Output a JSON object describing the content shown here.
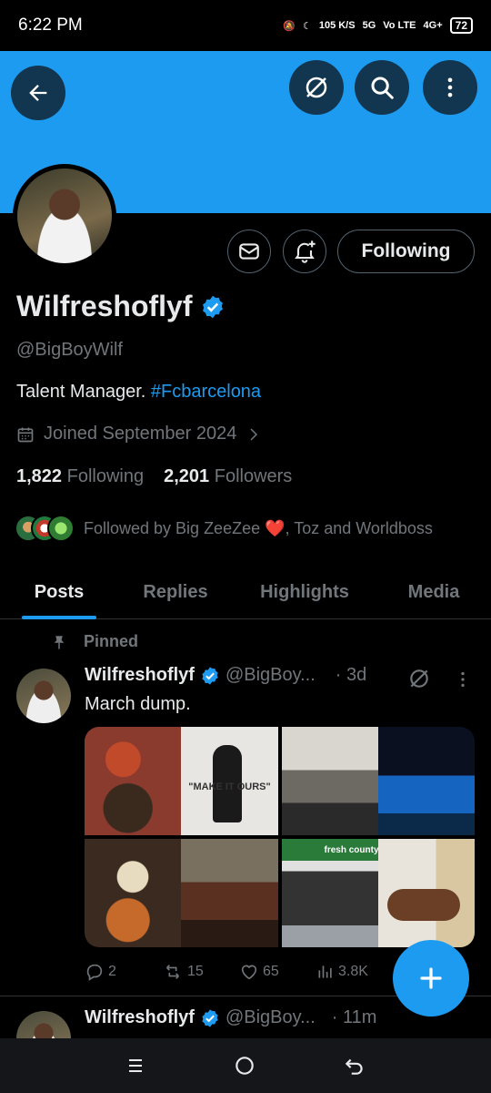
{
  "status_bar": {
    "time": "6:22 PM",
    "net_speed": "105 K/S",
    "net_1": "5G",
    "net_2": "Vo LTE",
    "net_3": "4G+",
    "battery": "72"
  },
  "header": {
    "back_icon": "arrow-left-icon",
    "grok_icon": "grok-icon",
    "search_icon": "search-icon",
    "more_icon": "more-vertical-icon",
    "banner_color": "#1d9bf0"
  },
  "profile": {
    "display_name": "Wilfreshoflyf",
    "handle": "@BigBoyWilf",
    "bio_text": "Talent Manager. ",
    "bio_tag": "#Fcbarcelona",
    "joined": "Joined September 2024",
    "following_count": "1,822",
    "following_label": "Following",
    "followers_count": "2,201",
    "followers_label": "Followers",
    "followed_by": "Followed by Big ZeeZee ❤️, Toz and Worldboss",
    "follow_button": "Following"
  },
  "tabs": [
    {
      "label": "Posts",
      "active": true
    },
    {
      "label": "Replies",
      "active": false
    },
    {
      "label": "Highlights",
      "active": false
    },
    {
      "label": "Media",
      "active": false
    }
  ],
  "pinned_post": {
    "pinned_label": "Pinned",
    "name": "Wilfreshoflyf",
    "handle": "@BigBoy...",
    "time": "· 3d",
    "text": "March dump.",
    "media_text_1": "\"MAKE IT OURS\"",
    "media_text_2": "fresh county",
    "replies": "2",
    "reposts": "15",
    "likes": "65",
    "views": "3.8K"
  },
  "next_post": {
    "name": "Wilfreshoflyf",
    "handle": "@BigBoy...",
    "time": "· 11m"
  },
  "colors": {
    "accent": "#1d9bf0",
    "muted": "#71767b",
    "text": "#e7e9ea"
  }
}
